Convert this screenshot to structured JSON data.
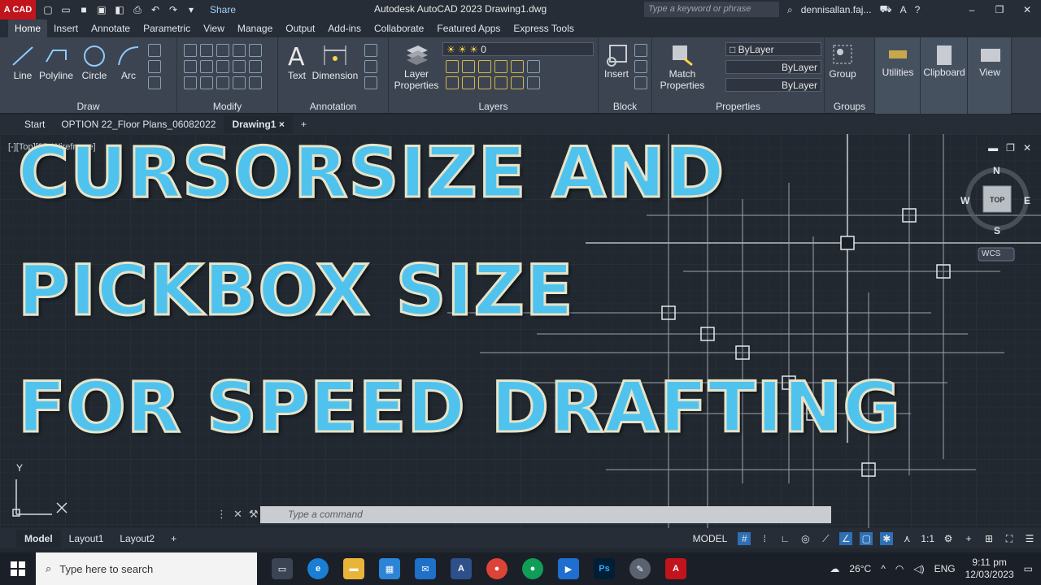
{
  "titlebar": {
    "app_logo": "A CAD",
    "share_label": "Share",
    "title": "Autodesk AutoCAD 2023   Drawing1.dwg",
    "search_placeholder": "Type a keyword or phrase",
    "user": "dennisallan.faj..."
  },
  "ribbon_tabs": [
    "Home",
    "Insert",
    "Annotate",
    "Parametric",
    "View",
    "Manage",
    "Output",
    "Add-ins",
    "Collaborate",
    "Featured Apps",
    "Express Tools"
  ],
  "ribbon": {
    "draw": {
      "title": "Draw",
      "tools": [
        "Line",
        "Polyline",
        "Circle",
        "Arc"
      ]
    },
    "modify": {
      "title": "Modify"
    },
    "annotation": {
      "title": "Annotation",
      "tools": [
        "Text",
        "Dimension"
      ]
    },
    "layers": {
      "title": "Layers",
      "tool": "Layer Properties",
      "layer_value": "0"
    },
    "block": {
      "title": "Block",
      "tool": "Insert"
    },
    "properties": {
      "title": "Properties",
      "tool": "Match Properties",
      "color": "ByLayer",
      "linetype": "ByLayer",
      "lineweight": "ByLayer"
    },
    "groups": {
      "title": "Groups",
      "tool": "Group"
    },
    "utilities": "Utilities",
    "clipboard": "Clipboard",
    "view": "View"
  },
  "file_tabs": [
    "Start",
    "OPTION 22_Floor Plans_06082022",
    "Drawing1"
  ],
  "viewport": {
    "label": "[-][Top][2D Wireframe]",
    "compass": {
      "n": "N",
      "s": "S",
      "e": "E",
      "w": "W",
      "top": "TOP",
      "wcs": "WCS"
    },
    "ucs_y": "Y"
  },
  "overlay": {
    "line1": "CURSORSIZE AND",
    "line2": "PICKBOX SIZE",
    "line3": "FOR SPEED DRAFTING"
  },
  "command": {
    "placeholder": "Type  a  command"
  },
  "layout_tabs": [
    "Model",
    "Layout1",
    "Layout2"
  ],
  "status": {
    "model": "MODEL",
    "scale": "1:1"
  },
  "taskbar": {
    "search": "Type here to search",
    "temp": "26°C",
    "lang": "ENG",
    "time": "9:11 pm",
    "date": "12/03/2023"
  },
  "colors": {
    "accent": "#4fc3ee",
    "outline": "#e7e3c8",
    "canvas": "#212830",
    "ribbon": "#3b4450"
  }
}
